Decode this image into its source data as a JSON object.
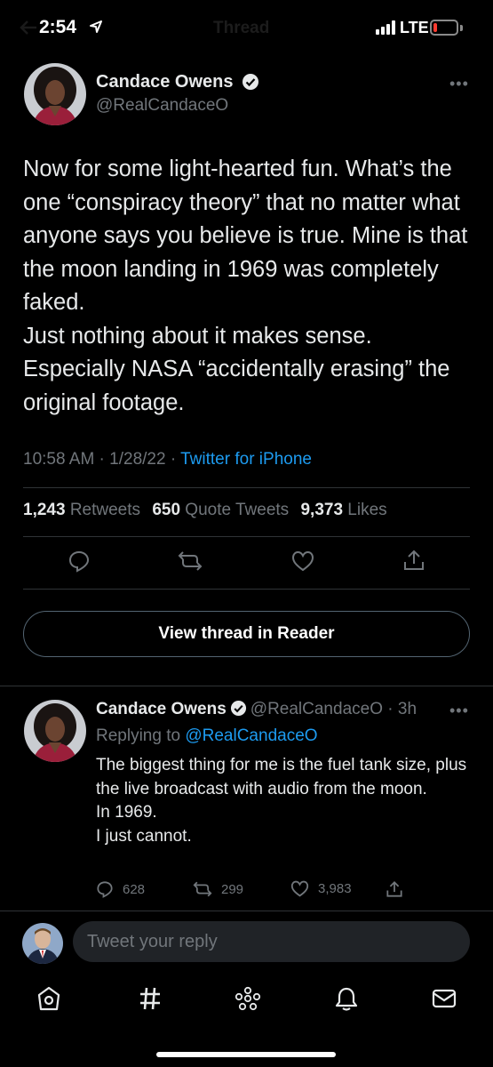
{
  "status_bar": {
    "time": "2:54",
    "network": "LTE",
    "faded_title": "Thread"
  },
  "tweet": {
    "author_name": "Candace Owens",
    "handle": "@RealCandaceO",
    "text": "Now for some light-hearted fun. What’s the one “conspiracy theory” that no matter what anyone says you believe is true. Mine is that the moon landing in 1969 was completely faked.\nJust nothing about it makes sense. Especially NASA “accidentally erasing” the original footage.",
    "time": "10:58 AM",
    "date": "1/28/22",
    "source": "Twitter for iPhone",
    "retweets_count": "1,243",
    "retweets_label": "Retweets",
    "quotes_count": "650",
    "quotes_label": "Quote Tweets",
    "likes_count": "9,373",
    "likes_label": "Likes"
  },
  "view_thread_label": "View thread in Reader",
  "reply": {
    "author_name": "Candace Owens",
    "handle": "@RealCandaceO",
    "age": "3h",
    "replying_prefix": "Replying to",
    "replying_to": "@RealCandaceO",
    "text": "The biggest thing for me is the fuel tank size, plus the live broadcast with audio from the moon.\nIn 1969.\nI just cannot.",
    "replies": "628",
    "retweets": "299",
    "likes": "3,983"
  },
  "composer": {
    "placeholder": "Tweet your reply"
  },
  "tabs": [
    "home",
    "explore",
    "spaces",
    "notifications",
    "messages"
  ],
  "colors": {
    "accent": "#1d9bf0",
    "battery_low": "#ff3b30"
  }
}
